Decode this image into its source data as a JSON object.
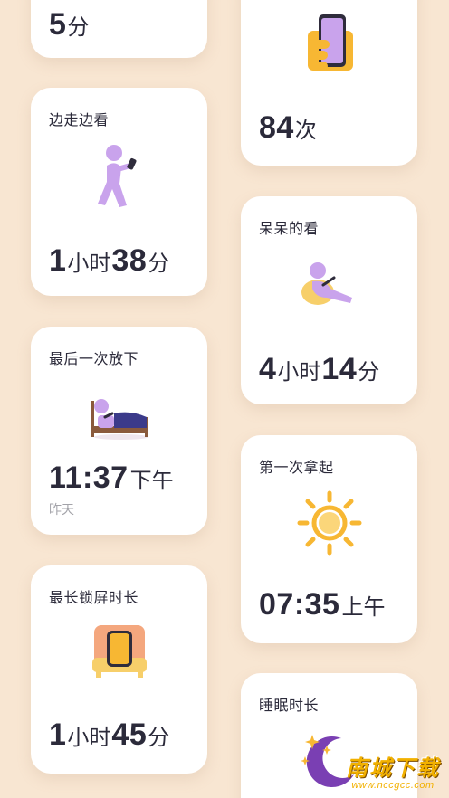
{
  "cards": {
    "top_left": {
      "num": "5",
      "unit": "分"
    },
    "pickups": {
      "num": "84",
      "unit": "次",
      "icon": "hand-holding-phone-icon"
    },
    "walking": {
      "title": "边走边看",
      "icon": "walking-person-icon",
      "v1": "1",
      "u1": "小时",
      "v2": "38",
      "u2": "分"
    },
    "idle": {
      "title": "呆呆的看",
      "icon": "reclining-person-icon",
      "v1": "4",
      "u1": "小时",
      "v2": "14",
      "u2": "分"
    },
    "last_putdown": {
      "title": "最后一次放下",
      "icon": "bed-icon",
      "time": "11:37",
      "ampm": "下午",
      "day": "昨天"
    },
    "first_pickup": {
      "title": "第一次拿起",
      "icon": "sun-icon",
      "time": "07:35",
      "ampm": "上午"
    },
    "longest_lock": {
      "title": "最长锁屏时长",
      "icon": "phone-on-sofa-icon",
      "v1": "1",
      "u1": "小时",
      "v2": "45",
      "u2": "分"
    },
    "sleep": {
      "title": "睡眠时长",
      "icon": "moon-stars-icon"
    }
  },
  "watermark": {
    "title": "南城下载",
    "url": "www.nccgcc.com"
  },
  "colors": {
    "background": "#f8e6d2",
    "accent_purple": "#c9a3ec",
    "accent_yellow": "#f7b733",
    "text": "#2b2a3a"
  }
}
